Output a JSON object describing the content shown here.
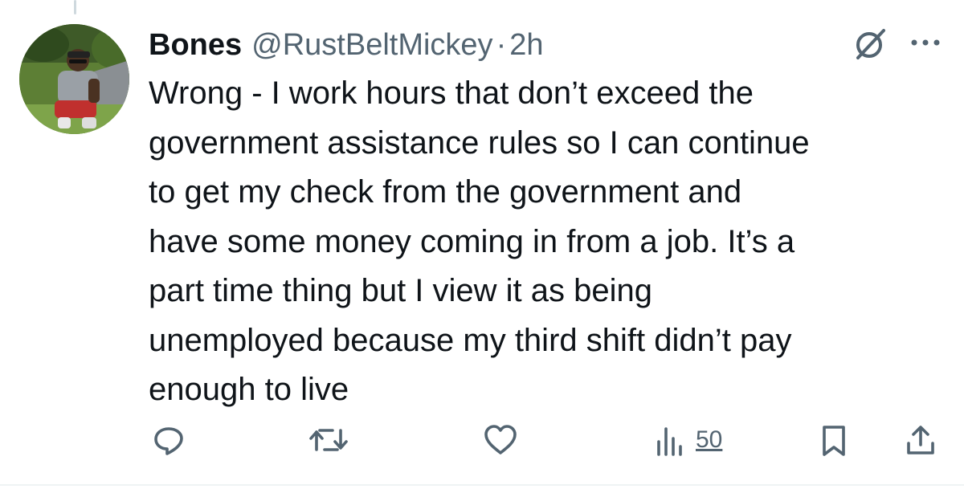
{
  "tweet": {
    "author_name": "Bones",
    "author_handle": "@RustBeltMickey",
    "separator": "·",
    "time": "2h",
    "text": "Wrong - I work hours that don’t exceed the\ngovernment assistance rules so I can continue\nto get my check from the government and\nhave some money coming in from a job. It’s a\npart time thing but I view it as being\nunemployed because my third shift didn’t pay\nenough to live",
    "views_count": "50"
  },
  "icons": {
    "reply": "reply-icon",
    "retweet": "retweet-icon",
    "like": "heart-icon",
    "views": "views-icon",
    "bookmark": "bookmark-icon",
    "share": "share-icon",
    "grok": "grok-icon",
    "more": "more-icon"
  },
  "colors": {
    "text": "#0f1419",
    "secondary": "#536471",
    "divider": "#eff3f4"
  }
}
